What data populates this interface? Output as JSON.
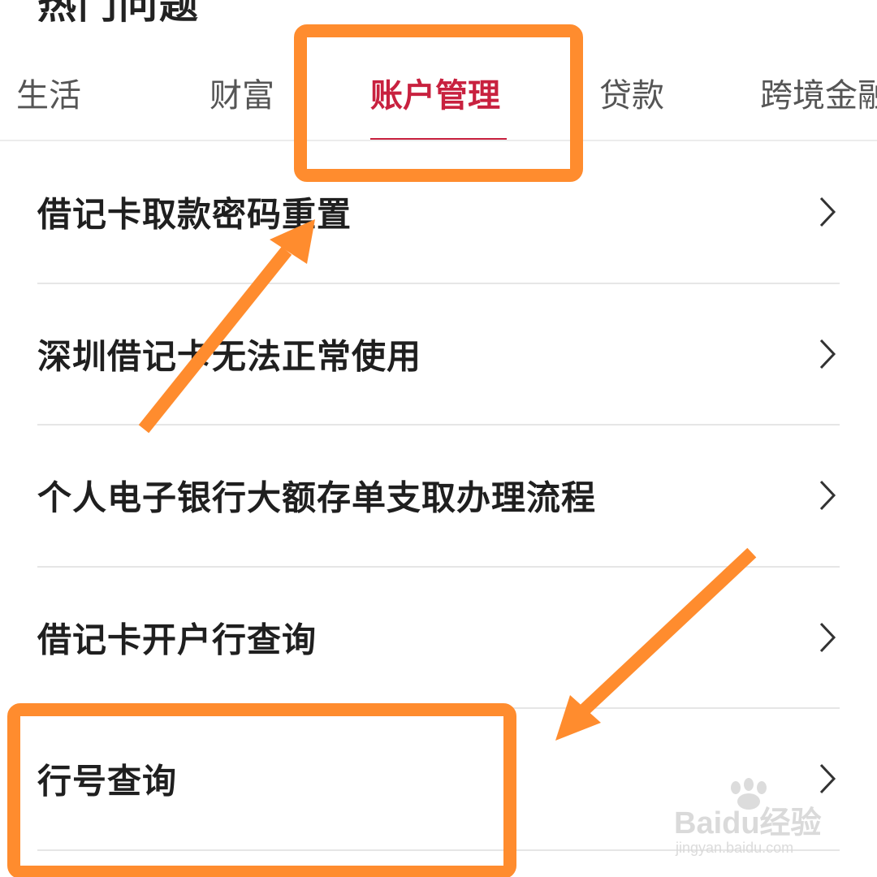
{
  "section": {
    "title": "热门问题"
  },
  "tabs": [
    {
      "label": "生活",
      "active": false
    },
    {
      "label": "财富",
      "active": false
    },
    {
      "label": "账户管理",
      "active": true
    },
    {
      "label": "贷款",
      "active": false
    },
    {
      "label": "跨境金融",
      "active": false
    }
  ],
  "list": {
    "items": [
      {
        "label": "借记卡取款密码重置"
      },
      {
        "label": "深圳借记卡无法正常使用"
      },
      {
        "label": "个人电子银行大额存单支取办理流程"
      },
      {
        "label": "借记卡开户行查询"
      },
      {
        "label": "行号查询"
      }
    ]
  },
  "icons": {
    "row_chevron": "chevron-right-icon"
  },
  "watermark": {
    "brand": "Baidu经验",
    "site": "jingyan.baidu.com"
  },
  "colors": {
    "active_tab": "#c8213f",
    "annotation": "#ff8c2e",
    "text": "#1f1f1f",
    "inactive_tab": "#555555"
  }
}
